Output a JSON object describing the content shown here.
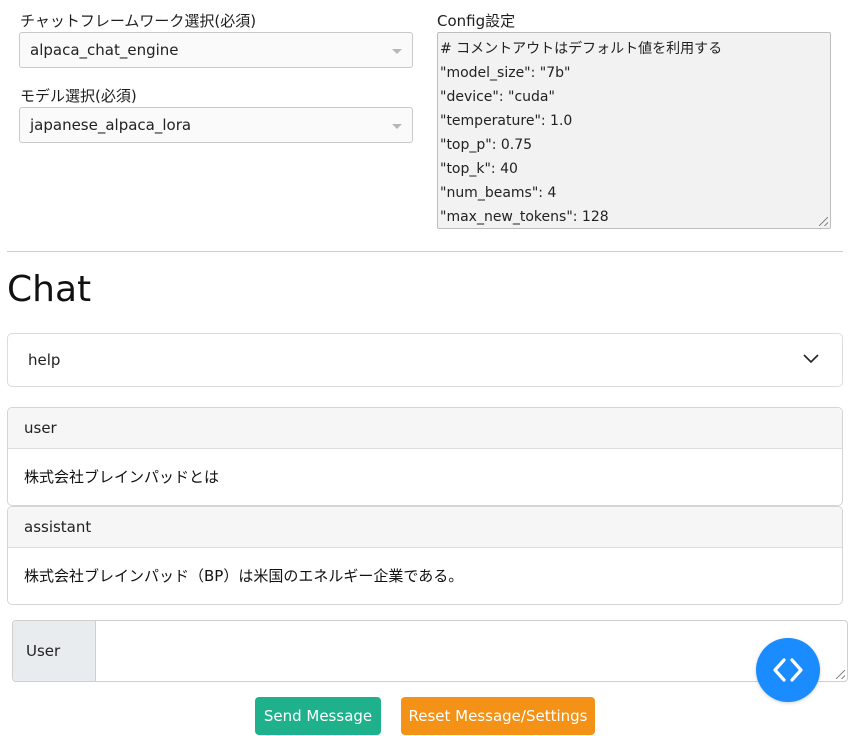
{
  "settings": {
    "framework_label": "チャットフレームワーク選択(必須)",
    "framework_value": "alpaca_chat_engine",
    "model_label": "モデル選択(必須)",
    "model_value": "japanese_alpaca_lora",
    "config_label": "Config設定",
    "config_lines": [
      "# コメントアウトはデフォルト値を利用する",
      "\"model_size\": \"7b\"",
      "\"device\": \"cuda\"",
      "\"temperature\": 1.0",
      "\"top_p\": 0.75",
      "\"top_k\": 40",
      "\"num_beams\": 4",
      "\"max_new_tokens\": 128"
    ]
  },
  "chat": {
    "title": "Chat",
    "help_label": "help",
    "messages": [
      {
        "role": "user",
        "text": "株式会社ブレインパッドとは"
      },
      {
        "role": "assistant",
        "text": "株式会社ブレインパッド（BP）は米国のエネルギー企業である。"
      }
    ]
  },
  "input": {
    "addon_label": "User",
    "value": ""
  },
  "buttons": {
    "send_label": "Send Message",
    "reset_label": "Reset Message/Settings"
  },
  "colors": {
    "send": "#1fb18b",
    "reset": "#f39217",
    "fab": "#1a8cff"
  },
  "icons": {
    "fab": "code-icon",
    "accordion": "chevron-down-icon"
  }
}
